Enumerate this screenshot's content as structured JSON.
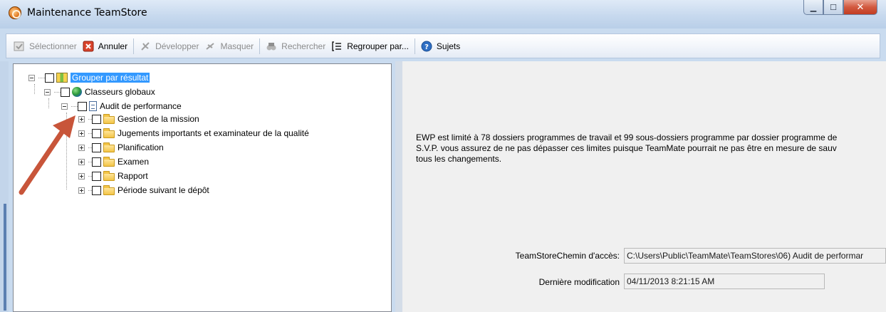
{
  "window": {
    "title": "Maintenance TeamStore"
  },
  "toolbar": {
    "select_label": "Sélectionner",
    "cancel_label": "Annuler",
    "expand_label": "Développer",
    "hide_label": "Masquer",
    "search_label": "Rechercher",
    "group_label": "Regrouper par...",
    "help_label": "Sujets"
  },
  "tree": {
    "root": "Grouper par résultat",
    "global": "Classeurs globaux",
    "audit": "Audit de performance",
    "folders": [
      "Gestion de la mission",
      "Jugements importants et examinateur de la qualité",
      "Planification",
      "Examen",
      "Rapport",
      "Période suivant le dépôt"
    ]
  },
  "info": {
    "line1": "EWP est limité à 78 dossiers programmes de travail et 99 sous-dossiers programme par dossier programme de",
    "line2": "S.V.P. vous assurez de ne pas dépasser ces limites puisque TeamMate pourrait ne pas être en mesure de sauv",
    "line3": "tous les changements."
  },
  "fields": {
    "path_label": "TeamStoreChemin d'accès:",
    "path_value": "C:\\Users\\Public\\TeamMate\\TeamStores\\06) Audit de performar",
    "modified_label": "Dernière modification",
    "modified_value": "04/11/2013 8:21:15 AM"
  },
  "colors": {
    "selection": "#3399ff",
    "arrow": "#c8553a",
    "close_button": "#c94a30"
  }
}
